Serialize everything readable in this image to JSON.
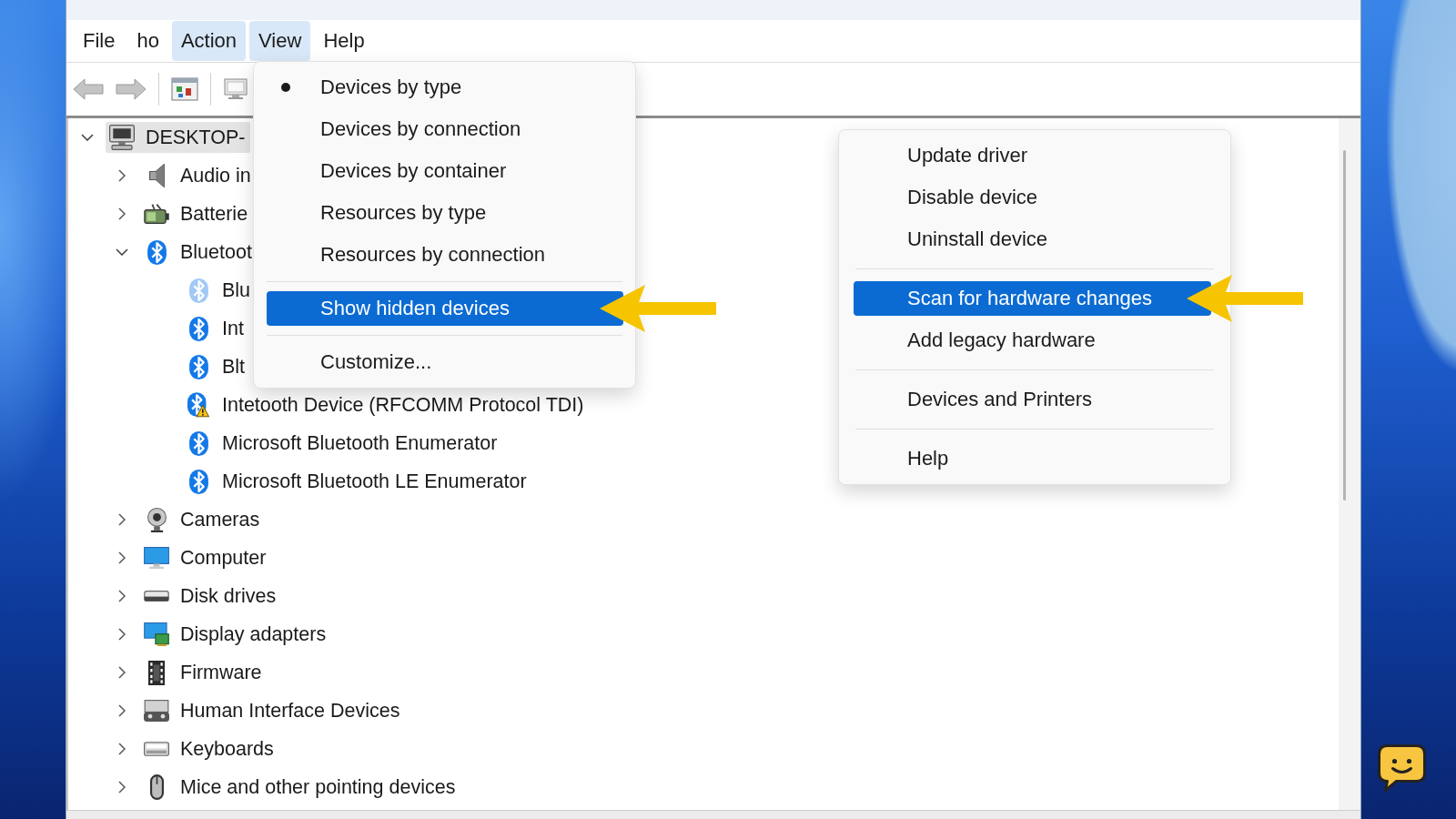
{
  "menu_bar": [
    {
      "label": "File",
      "highlighted": false
    },
    {
      "label": "ho",
      "highlighted": false
    },
    {
      "label": "Action",
      "highlighted": true
    },
    {
      "label": "View",
      "highlighted": true
    },
    {
      "label": "Help",
      "highlighted": false
    }
  ],
  "view_menu": {
    "groups": [
      [
        {
          "label": "Devices by type",
          "checked": true,
          "highlighted": false,
          "arrow": false
        },
        {
          "label": "Devices by connection",
          "checked": false,
          "highlighted": false,
          "arrow": false
        },
        {
          "label": "Devices by container",
          "checked": false,
          "highlighted": false,
          "arrow": false
        },
        {
          "label": "Resources by type",
          "checked": false,
          "highlighted": false,
          "arrow": false
        },
        {
          "label": "Resources by connection",
          "checked": false,
          "highlighted": false,
          "arrow": false
        }
      ],
      [
        {
          "label": "Show hidden devices",
          "checked": false,
          "highlighted": true,
          "arrow": true
        }
      ],
      [
        {
          "label": "Customize...",
          "checked": false,
          "highlighted": false,
          "arrow": false
        }
      ]
    ]
  },
  "tree": [
    {
      "label": "DESKTOP-",
      "kind": "computer",
      "expanded": true,
      "selected": true,
      "children": [
        {
          "label": "Audio in",
          "kind": "audio",
          "expanded": false,
          "selected": false
        },
        {
          "label": "Batterie",
          "kind": "battery",
          "expanded": false,
          "selected": false
        },
        {
          "label": "Bluetoot",
          "kind": "bluetooth",
          "expanded": true,
          "selected": false,
          "children": [
            {
              "label": "Blu",
              "kind": "bluetooth",
              "selected": false,
              "hidden": true,
              "warning": false
            },
            {
              "label": "Int",
              "kind": "bluetooth",
              "selected": false,
              "hidden": false,
              "warning": false
            },
            {
              "label": "Blt",
              "kind": "bluetooth",
              "selected": false,
              "hidden": false,
              "warning": false
            },
            {
              "label": "Intetooth Device (RFCOMM Protocol TDI)",
              "kind": "bluetooth",
              "selected": false,
              "hidden": false,
              "warning": true
            },
            {
              "label": "Microsoft Bluetooth Enumerator",
              "kind": "bluetooth",
              "selected": false,
              "hidden": false,
              "warning": false
            },
            {
              "label": "Microsoft Bluetooth LE Enumerator",
              "kind": "bluetooth",
              "selected": false,
              "hidden": false,
              "warning": false
            }
          ]
        },
        {
          "label": "Cameras",
          "kind": "camera",
          "expanded": false,
          "selected": false
        },
        {
          "label": "Computer",
          "kind": "monitor",
          "expanded": false,
          "selected": false
        },
        {
          "label": "Disk drives",
          "kind": "disk",
          "expanded": false,
          "selected": false
        },
        {
          "label": "Display adapters",
          "kind": "display",
          "expanded": false,
          "selected": false
        },
        {
          "label": "Firmware",
          "kind": "firmware",
          "expanded": false,
          "selected": false
        },
        {
          "label": "Human Interface Devices",
          "kind": "hid",
          "expanded": false,
          "selected": false
        },
        {
          "label": "Keyboards",
          "kind": "keyboard",
          "expanded": false,
          "selected": false
        },
        {
          "label": "Mice and other pointing devices",
          "kind": "mouse",
          "expanded": false,
          "selected": false
        }
      ]
    }
  ],
  "context_menu": {
    "groups": [
      [
        {
          "label": "Update driver",
          "highlighted": false,
          "arrow": false
        },
        {
          "label": "Disable device",
          "highlighted": false,
          "arrow": false
        },
        {
          "label": "Uninstall device",
          "highlighted": false,
          "arrow": false
        }
      ],
      [
        {
          "label": "Scan for hardware changes",
          "highlighted": true,
          "arrow": true
        },
        {
          "label": "Add legacy hardware",
          "highlighted": false,
          "arrow": false
        }
      ],
      [
        {
          "label": "Devices and Printers",
          "highlighted": false,
          "arrow": false
        }
      ],
      [
        {
          "label": "Help",
          "highlighted": false,
          "arrow": false
        }
      ]
    ]
  }
}
